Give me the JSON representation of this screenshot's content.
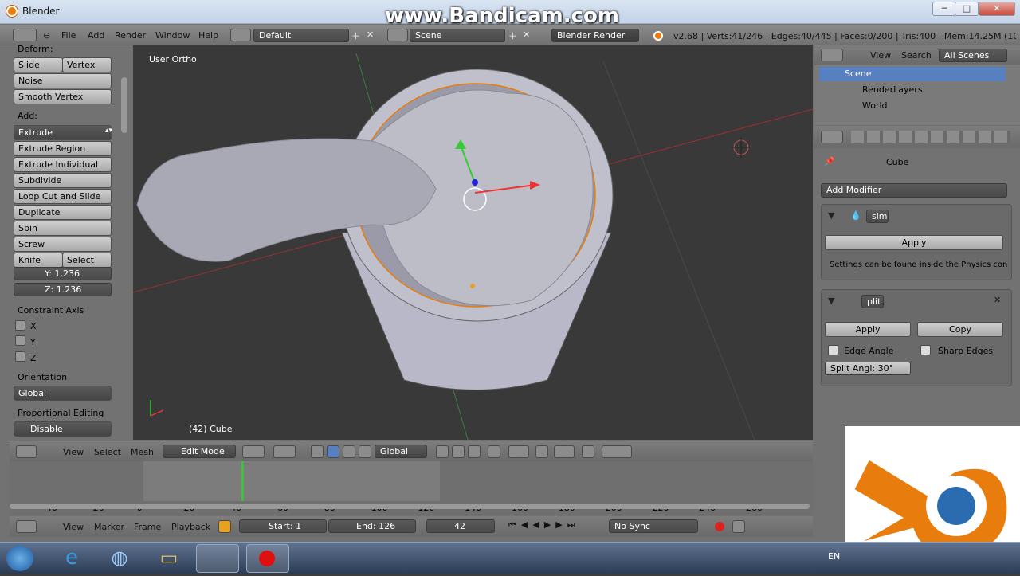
{
  "window": {
    "title": "Blender",
    "min": "─",
    "max": "□",
    "close": "✕"
  },
  "watermark": "www.Bandicam.com",
  "menu": {
    "items": [
      "File",
      "Add",
      "Render",
      "Window",
      "Help"
    ],
    "layout": "Default",
    "scene": "Scene",
    "engine": "Blender Render",
    "stats": "v2.68 | Verts:41/246 | Edges:40/445 | Faces:0/200 | Tris:400 | Mem:14.25M (10.39M"
  },
  "toolshelf": {
    "deform_label": "Deform:",
    "deform": [
      "Slide Edge",
      "Vertex",
      "Noise",
      "Smooth Vertex"
    ],
    "add_label": "Add:",
    "add": [
      "Extrude",
      "Extrude Region",
      "Extrude Individual",
      "Subdivide",
      "Loop Cut and Slide",
      "Duplicate",
      "Spin",
      "Screw",
      "Knife",
      "Select"
    ],
    "y_field": "Y: 1.236",
    "z_field": "Z: 1.236",
    "constraint_label": "Constraint Axis",
    "axes": [
      "X",
      "Y",
      "Z"
    ],
    "orientation_label": "Orientation",
    "orientation": "Global",
    "proportional_label": "Proportional Editing",
    "proportional": "Disable"
  },
  "viewport": {
    "view_name": "User Ortho",
    "object_label": "(42) Cube"
  },
  "vpheader": {
    "items": [
      "View",
      "Select",
      "Mesh"
    ],
    "mode": "Edit Mode",
    "orientation": "Global"
  },
  "timeline": {
    "ticks": [
      "-40",
      "-20",
      "0",
      "20",
      "40",
      "60",
      "80",
      "100",
      "120",
      "140",
      "160",
      "180",
      "200",
      "220",
      "240",
      "260"
    ],
    "current": 40
  },
  "tlheader": {
    "items": [
      "View",
      "Marker",
      "Frame",
      "Playback"
    ],
    "start": "Start: 1",
    "end": "End: 126",
    "frame": "42",
    "sync": "No Sync"
  },
  "outliner": {
    "items": [
      "View",
      "Search"
    ],
    "filter": "All Scenes",
    "tree": [
      "Scene",
      "RenderLayers",
      "World"
    ]
  },
  "props": {
    "object": "Cube",
    "add_modifier": "Add Modifier",
    "mod1": {
      "name": "sim",
      "apply": "Apply",
      "info": "Settings can be found inside the Physics con"
    },
    "mod2": {
      "name": "plit",
      "apply": "Apply",
      "copy": "Copy",
      "edge_angle": "Edge Angle",
      "sharp_edges": "Sharp Edges",
      "split_angle": "Split Angl: 30°"
    }
  },
  "taskbar": {
    "lang": "EN"
  },
  "colors": {
    "accent": "#e87d0d",
    "selected": "#5680c2",
    "viewport": "#393939"
  }
}
